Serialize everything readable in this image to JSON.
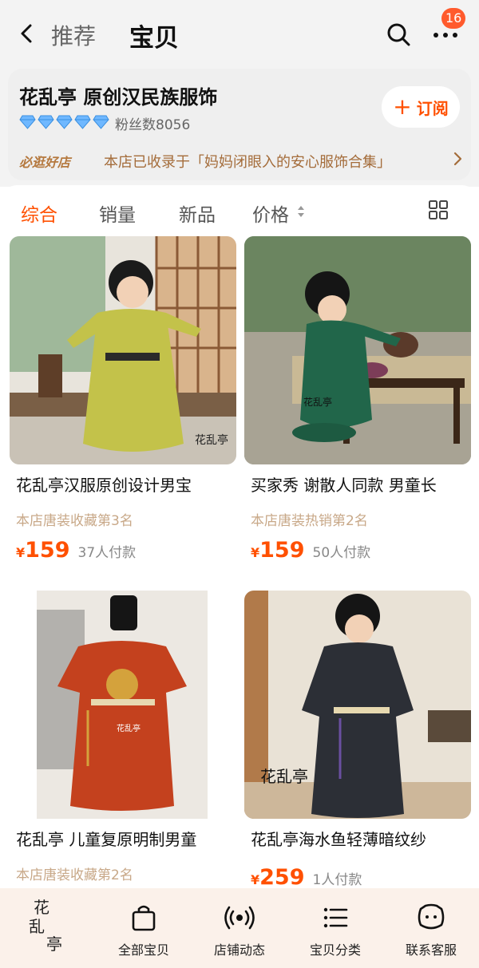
{
  "header": {
    "back_icon": "chevron-left-icon",
    "tabs": [
      "推荐",
      "宝贝"
    ],
    "active_tab": "宝贝",
    "search_icon": "search-icon",
    "more_icon": "more-dots-icon",
    "badge_count": "16"
  },
  "shop": {
    "name": "花乱亭 原创汉民族服饰",
    "diamond_count": 5,
    "fans_text": "粉丝数8056",
    "subscribe_label": "订阅",
    "promo_tag": "必逛好店",
    "promo_text": "本店已收录于「妈妈闭眼入的安心服饰合集」"
  },
  "sort_bar": {
    "items": [
      "综合",
      "销量",
      "新品",
      "价格"
    ],
    "active": "综合",
    "layout_icon": "grid-icon"
  },
  "products": [
    {
      "title": "花乱亭汉服原创设计男宝",
      "rank": "本店唐装收藏第3名",
      "currency": "¥",
      "price": "159",
      "paid": "37人付款",
      "watermark": "花乱亭"
    },
    {
      "title": "买家秀 谢散人同款 男童长",
      "rank": "本店唐装热销第2名",
      "currency": "¥",
      "price": "159",
      "paid": "50人付款",
      "watermark": "花乱亭"
    },
    {
      "title": "花乱亭 儿童复原明制男童",
      "rank": "本店唐装收藏第2名",
      "currency": "",
      "price": "",
      "paid": "",
      "watermark": "花乱亭"
    },
    {
      "title": "花乱亭海水鱼轻薄暗纹纱",
      "rank": "",
      "currency": "¥",
      "price": "259",
      "paid": "1人付款",
      "watermark": "花乱亭"
    }
  ],
  "bottom_nav": {
    "logo_text": [
      "花",
      "乱",
      "亭"
    ],
    "items": [
      {
        "label": "全部宝贝",
        "icon": "shopping-bag-icon"
      },
      {
        "label": "店铺动态",
        "icon": "broadcast-icon"
      },
      {
        "label": "宝贝分类",
        "icon": "list-icon"
      },
      {
        "label": "联系客服",
        "icon": "chat-face-icon"
      }
    ]
  },
  "colors": {
    "accent": "#ff5000",
    "badge": "#ff5a2c",
    "promo_text": "#a46c3a",
    "rank_text": "#c8a888",
    "nav_bg": "#fbf1ea"
  }
}
